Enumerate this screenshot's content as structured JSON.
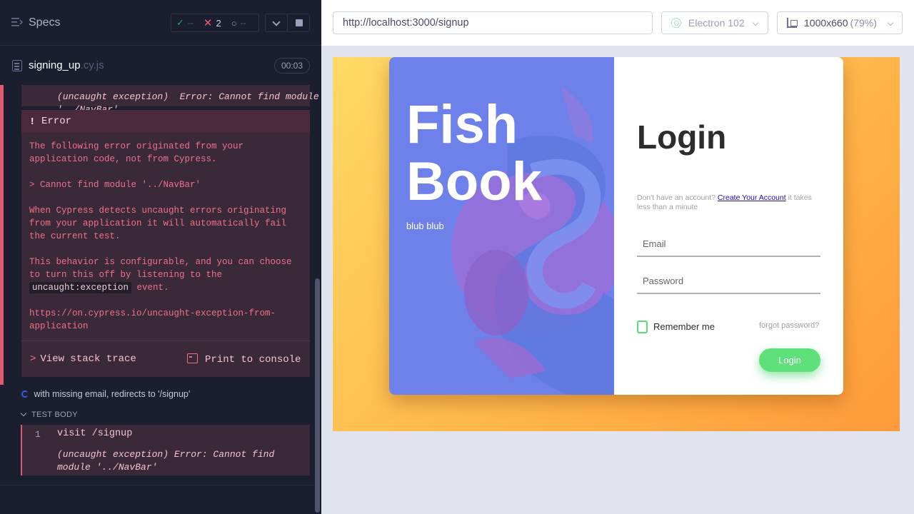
{
  "reporter": {
    "header": {
      "specs_label": "Specs",
      "passed": "--",
      "failed": "2",
      "pending": "--"
    },
    "spec": {
      "file_name": "signing_up",
      "file_ext": ".cy.js",
      "duration": "00:03"
    },
    "prev_error_text": "(uncaught exception)  Error: Cannot find module\n'../NavBar'",
    "error": {
      "title": "Error",
      "p1": "The following error originated from your application code, not from Cypress.",
      "p2": "> Cannot find module '../NavBar'",
      "p3": "When Cypress detects uncaught errors originating from your application it will automatically fail the current test.",
      "p4_before": "This behavior is configurable, and you can choose to turn this off by listening to the",
      "p4_code": "uncaught:exception",
      "p4_after": "event.",
      "p5": "https://on.cypress.io/uncaught-exception-from-application",
      "view_stack": "View stack trace",
      "print_console": "Print to console"
    },
    "test": {
      "title": "with missing email, redirects to '/signup'",
      "body_label": "TEST BODY",
      "cmd_num": "1",
      "cmd_text": "visit  /signup",
      "cmd_exception": "(uncaught exception)  Error: Cannot find module '../NavBar'"
    }
  },
  "aut": {
    "url": "http://localhost:3000/signup",
    "browser": "Electron 102",
    "viewport": "1000x660",
    "zoom": "(79%)",
    "app": {
      "brand": "Fish Book",
      "tagline": "blub blub",
      "login_title": "Login",
      "account_prompt": "Don't have an account?",
      "account_link": "Create Your Account",
      "account_suffix": "it takes less than a minute",
      "email_placeholder": "Email",
      "password_placeholder": "Password",
      "remember_label": "Remember me",
      "forgot_label": "forgot password?",
      "login_button": "Login"
    }
  }
}
